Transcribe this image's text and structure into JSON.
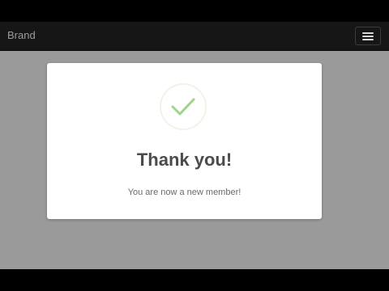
{
  "navbar": {
    "brand": "Brand",
    "menu_icon": "hamburger-menu-icon"
  },
  "modal": {
    "icon": "checkmark-icon",
    "title": "Thank you!",
    "message": "You are now a new member!"
  },
  "colors": {
    "navbar_bg": "#161616",
    "backdrop": "#9a9a9a",
    "check": "#9ed48c",
    "title": "#4b4b4b"
  }
}
